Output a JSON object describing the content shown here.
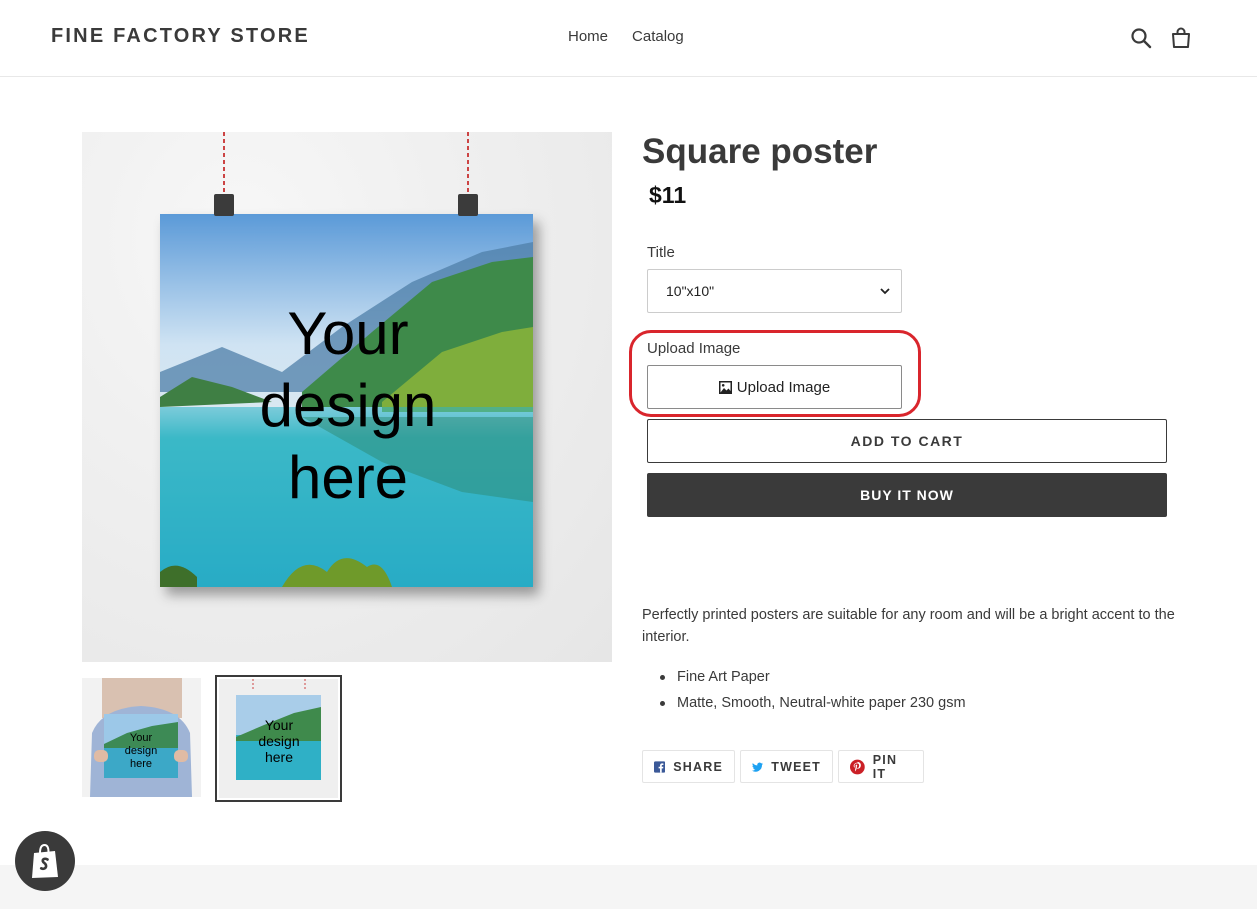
{
  "header": {
    "logo": "FINE FACTORY STORE",
    "nav": [
      {
        "label": "Home"
      },
      {
        "label": "Catalog"
      }
    ],
    "icons": [
      "search-icon",
      "cart-icon"
    ]
  },
  "product": {
    "title": "Square poster",
    "price": "$11",
    "image_text": [
      "Your",
      "design",
      "here"
    ],
    "thumbnails": [
      {
        "text": [
          "Your",
          "design",
          "here"
        ]
      },
      {
        "text": [
          "Your",
          "design",
          "here"
        ]
      }
    ],
    "option_label": "Title",
    "option_selected": "10\"x10\"",
    "upload_label": "Upload Image",
    "upload_button": "Upload Image",
    "add_to_cart": "ADD TO CART",
    "buy_now": "BUY IT NOW",
    "description": "Perfectly printed posters are suitable for any room and will be a bright accent to the interior.",
    "features": [
      "Fine Art Paper",
      "Matte, Smooth, Neutral-white paper 230 gsm"
    ]
  },
  "share": {
    "facebook": "SHARE",
    "twitter": "TWEET",
    "pinterest": "PIN IT"
  },
  "colors": {
    "highlight": "#d9252c",
    "primary_button": "#3a3a3a",
    "text": "#3a3a3a"
  }
}
